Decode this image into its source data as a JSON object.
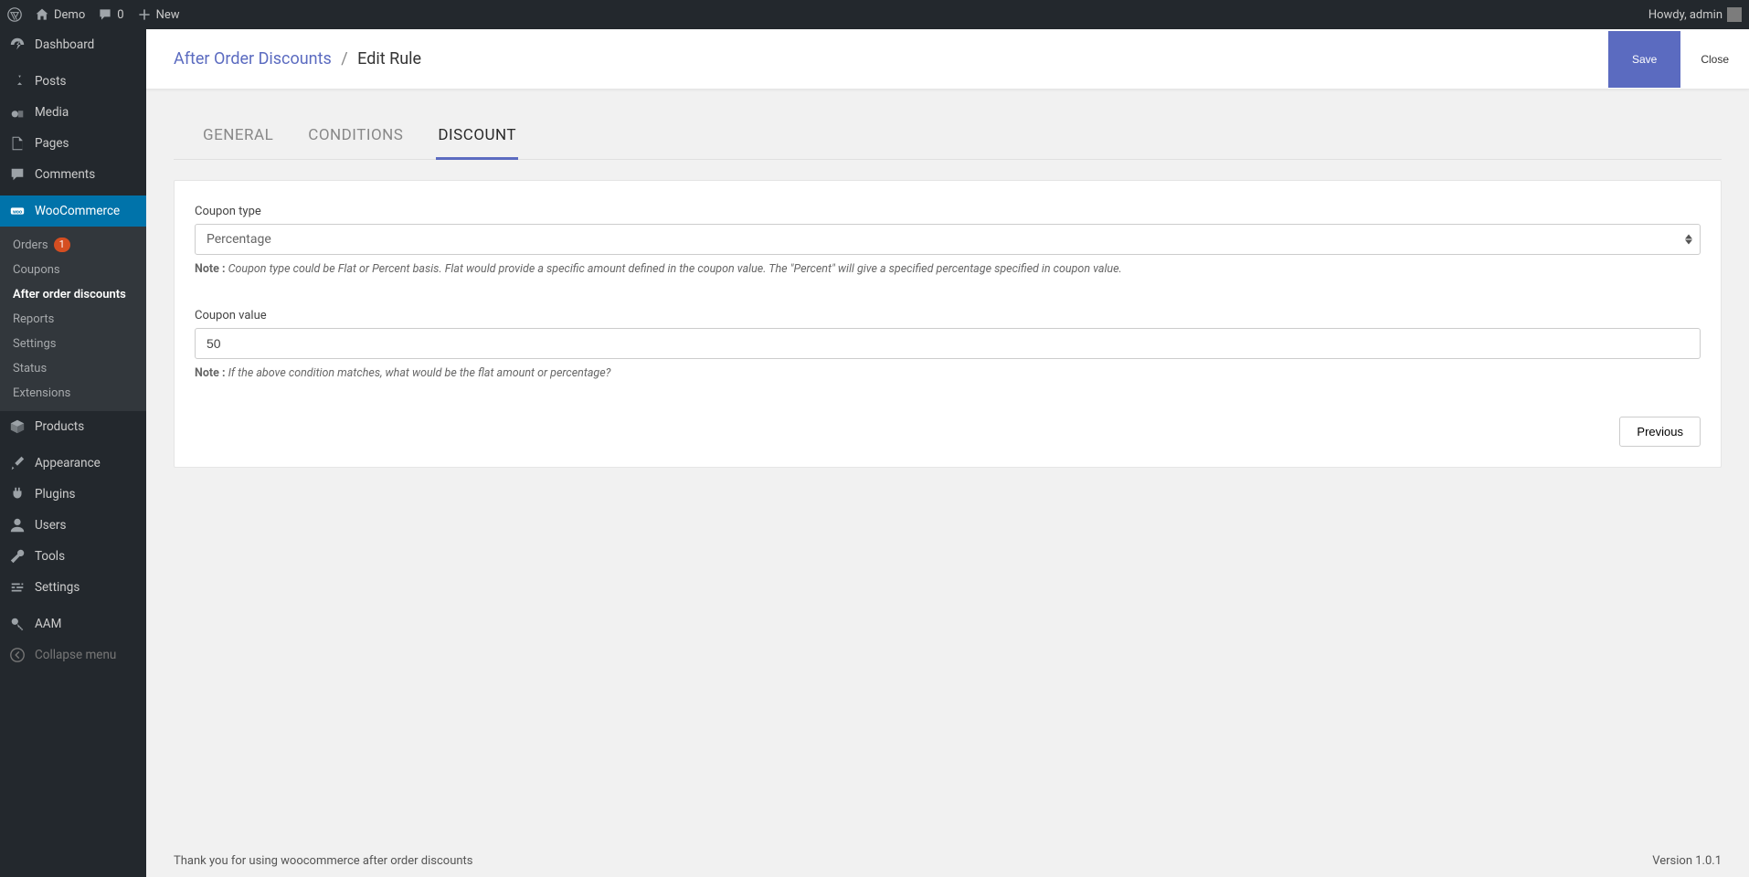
{
  "adminbar": {
    "site_name": "Demo",
    "comment_count": "0",
    "new_label": "New",
    "greeting": "Howdy, admin"
  },
  "sidebar": {
    "items": [
      {
        "label": "Dashboard"
      },
      {
        "label": "Posts"
      },
      {
        "label": "Media"
      },
      {
        "label": "Pages"
      },
      {
        "label": "Comments"
      },
      {
        "label": "WooCommerce"
      },
      {
        "label": "Products"
      },
      {
        "label": "Appearance"
      },
      {
        "label": "Plugins"
      },
      {
        "label": "Users"
      },
      {
        "label": "Tools"
      },
      {
        "label": "Settings"
      },
      {
        "label": "AAM"
      },
      {
        "label": "Collapse menu"
      }
    ],
    "woo_submenu": [
      {
        "label": "Orders",
        "badge": "1"
      },
      {
        "label": "Coupons"
      },
      {
        "label": "After order discounts"
      },
      {
        "label": "Reports"
      },
      {
        "label": "Settings"
      },
      {
        "label": "Status"
      },
      {
        "label": "Extensions"
      }
    ]
  },
  "header": {
    "crumb_parent": "After Order Discounts",
    "crumb_current": "Edit Rule",
    "save": "Save",
    "close": "Close"
  },
  "tabs": {
    "general": "GENERAL",
    "conditions": "CONDITIONS",
    "discount": "DISCOUNT"
  },
  "form": {
    "coupon_type_label": "Coupon type",
    "coupon_type_value": "Percentage",
    "coupon_type_note_label": "Note : ",
    "coupon_type_note": "Coupon type could be Flat or Percent basis. Flat would provide a specific amount defined in the coupon value. The \"Percent\" will give a specified percentage specified in coupon value.",
    "coupon_value_label": "Coupon value",
    "coupon_value": "50",
    "coupon_value_note_label": "Note : ",
    "coupon_value_note": "If the above condition matches, what would be the flat amount or percentage?",
    "previous": "Previous"
  },
  "footer": {
    "thanks": "Thank you for using woocommerce after order discounts",
    "version": "Version 1.0.1"
  }
}
